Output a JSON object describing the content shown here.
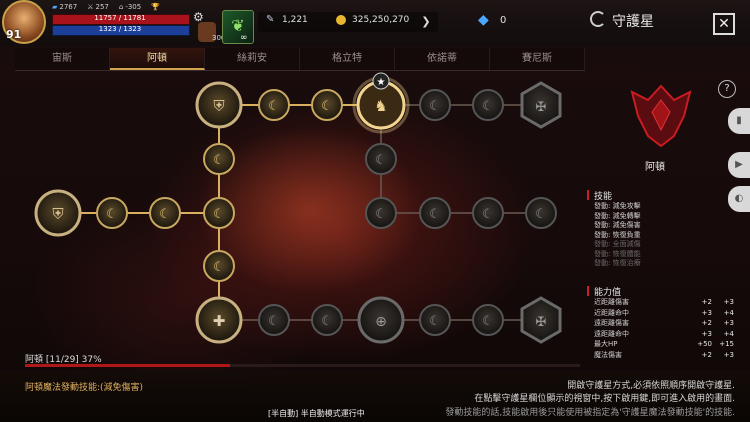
{
  "topbar": {
    "level": "91",
    "stat1": "2767",
    "stat2": "257",
    "stat3": "-305",
    "hp": "11757 / 11781",
    "mp": "1323 / 1323",
    "potion_count": "300",
    "leaf_count": "∞",
    "feather_value": "1,221",
    "gold_value": "325,250,270",
    "gem_value": "0",
    "page_title": "守護星"
  },
  "tabs": [
    "宙斯",
    "阿頓",
    "絲莉安",
    "格立特",
    "依諾蒂",
    "賽尼斯"
  ],
  "active_tab": 1,
  "tree": {
    "progress_label": "阿頓 [11/29] 37%",
    "progress": 0.37
  },
  "right_panel": {
    "emblem_name": "阿頓",
    "skills_title": "技能",
    "skills": [
      {
        "text": "發動: 減免攻擊",
        "active": true
      },
      {
        "text": "發動: 減免轉擊",
        "active": true
      },
      {
        "text": "發動: 減免傷害",
        "active": true
      },
      {
        "text": "發動: 恢復負重",
        "active": true
      },
      {
        "text": "發動: 全面減傷",
        "active": false
      },
      {
        "text": "發動: 恢復體能",
        "active": false
      },
      {
        "text": "發動: 恢復治療",
        "active": false
      }
    ],
    "abilities_title": "能力值",
    "abilities": [
      {
        "name": "近距離傷害",
        "current": "+2",
        "next": "+3"
      },
      {
        "name": "近距離命中",
        "current": "+3",
        "next": "+4"
      },
      {
        "name": "遠距離傷害",
        "current": "+2",
        "next": "+3"
      },
      {
        "name": "遠距離命中",
        "current": "+3",
        "next": "+4"
      },
      {
        "name": "最大HP",
        "current": "+50",
        "next": "+15"
      },
      {
        "name": "魔法傷害",
        "current": "+2",
        "next": "+3"
      }
    ]
  },
  "bottom": {
    "skill_line": "阿頓魔法發動技能:(減免傷害)",
    "help1": "開啟守護星方式,必須依照順序開啟守護星.",
    "help2": "在點擊守護星欄位顯示的視窗中,按下啟用鍵,即可進入啟用的畫面.",
    "help3": "發動技能的話,技能啟用後只能使用被指定為'守護星魔法發動技能'的技能.",
    "auto_mode": "[半自動] 半自動模式運行中"
  },
  "colors": {
    "accent_gold": "#d2a450",
    "hp_red": "#a8121a",
    "mp_blue": "#1c3f9a"
  }
}
